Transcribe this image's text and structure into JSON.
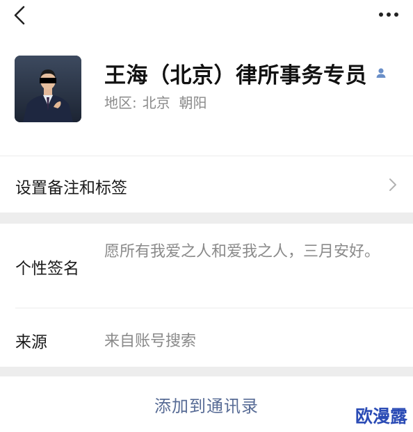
{
  "header": {
    "back_icon": "chevron-left-icon",
    "more_icon": "ellipsis-icon"
  },
  "profile": {
    "name": "王海（北京）律所事务专员",
    "region_label": "地区:",
    "region_value": "北京  朝阳",
    "contact_icon": "person-icon",
    "accent_color": "#6a8fc8"
  },
  "remark_row": {
    "label": "设置备注和标签",
    "arrow_icon": "chevron-right-icon"
  },
  "signature": {
    "label": "个性签名",
    "text": "愿所有我爱之人和爱我之人，三月安好。"
  },
  "source": {
    "label": "来源",
    "value": "来自账号搜索"
  },
  "action": {
    "add_label": "添加到通讯录",
    "link_color": "#576b95"
  },
  "watermark": {
    "text": "欧漫露"
  }
}
